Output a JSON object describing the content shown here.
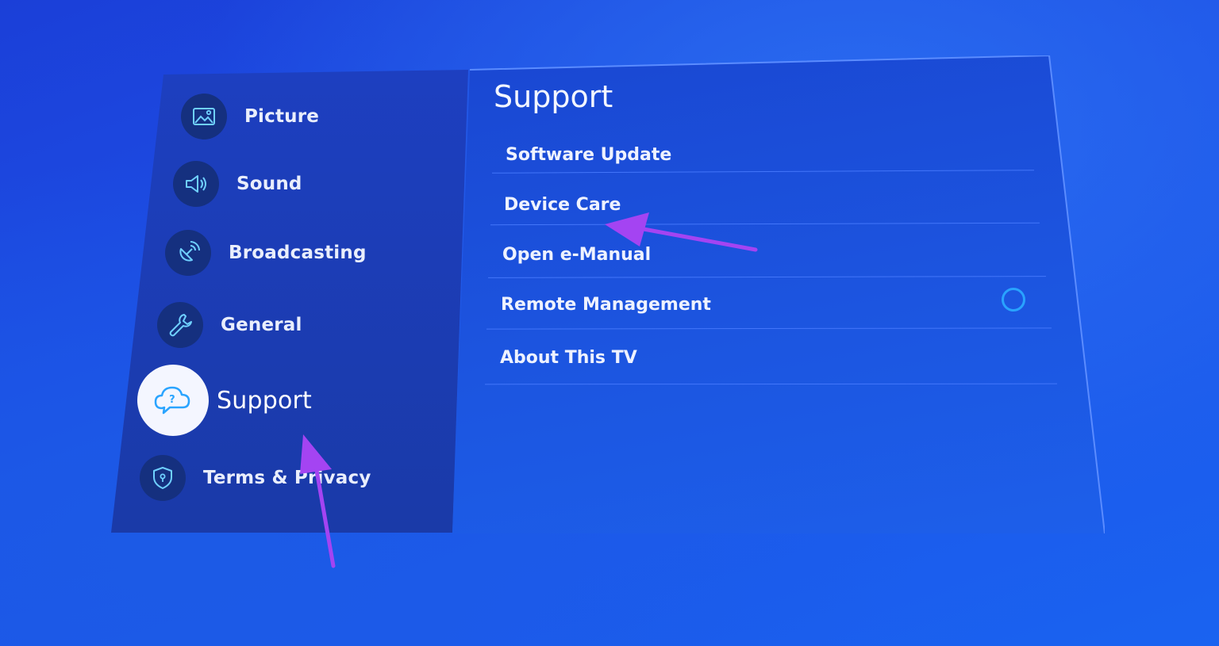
{
  "colors": {
    "background": "#1d52e8",
    "accent_ring": "#29a3ff",
    "annotation_arrow": "#a444f2"
  },
  "sidebar": {
    "items": [
      {
        "label": "Picture",
        "icon": "picture-icon"
      },
      {
        "label": "Sound",
        "icon": "speaker-icon"
      },
      {
        "label": "Broadcasting",
        "icon": "satellite-icon"
      },
      {
        "label": "General",
        "icon": "wrench-icon"
      },
      {
        "label": "Support",
        "icon": "support-cloud-icon",
        "selected": true
      },
      {
        "label": "Terms & Privacy",
        "icon": "shield-icon"
      }
    ]
  },
  "main": {
    "title": "Support",
    "options": [
      {
        "label": "Software Update"
      },
      {
        "label": "Device Care"
      },
      {
        "label": "Open e-Manual"
      },
      {
        "label": "Remote Management",
        "toggle": "off"
      },
      {
        "label": "About This TV"
      }
    ]
  }
}
